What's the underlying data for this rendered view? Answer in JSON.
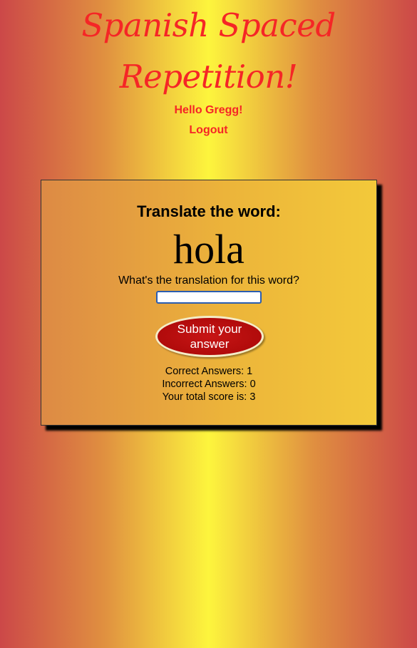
{
  "header": {
    "title_line1": "Spanish Spaced",
    "title_line2": "Repetition!",
    "greeting": "Hello Gregg!",
    "logout_label": "Logout"
  },
  "card": {
    "heading": "Translate the word:",
    "word": "hola",
    "question": "What's the translation for this word?",
    "answer_value": "",
    "submit_label": "Submit your answer",
    "stats": {
      "correct": "Correct Answers: 1",
      "incorrect": "Incorrect Answers: 0",
      "total": "Your total score is: 3"
    }
  },
  "colors": {
    "title_red": "#f52626",
    "button_red": "#b10b0b",
    "gradient_edge": "#cc4848",
    "gradient_center": "#fdf53d"
  }
}
